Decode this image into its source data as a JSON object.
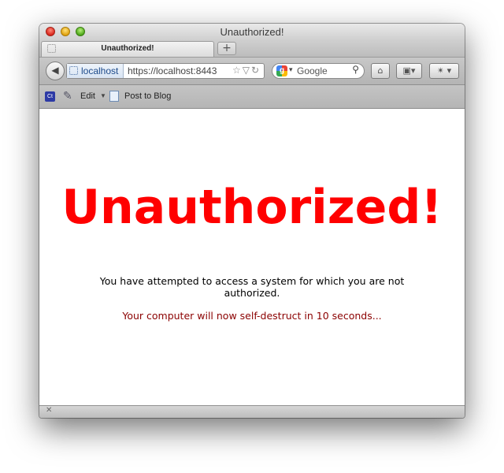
{
  "window": {
    "title": "Unauthorized!"
  },
  "tabs": [
    {
      "label": "Unauthorized!",
      "active": true
    }
  ],
  "new_tab_symbol": "+",
  "nav": {
    "site_identity": "localhost",
    "url": "https://localhost:8443",
    "search_placeholder": "Google"
  },
  "bookmarks": {
    "items": [
      {
        "icon": "ct-icon",
        "icon_text": "Ct"
      },
      {
        "label": "Edit",
        "icon": "edit-icon"
      },
      {
        "label": "Post to Blog",
        "icon": "post-icon"
      }
    ]
  },
  "page": {
    "headline": "Unauthorized!",
    "message": "You have attempted to access a system for which you are not authorized.",
    "warning": "Your computer will now self-destruct in 10 seconds..."
  },
  "colors": {
    "headline": "#ff0000",
    "warning": "#8b0000"
  }
}
